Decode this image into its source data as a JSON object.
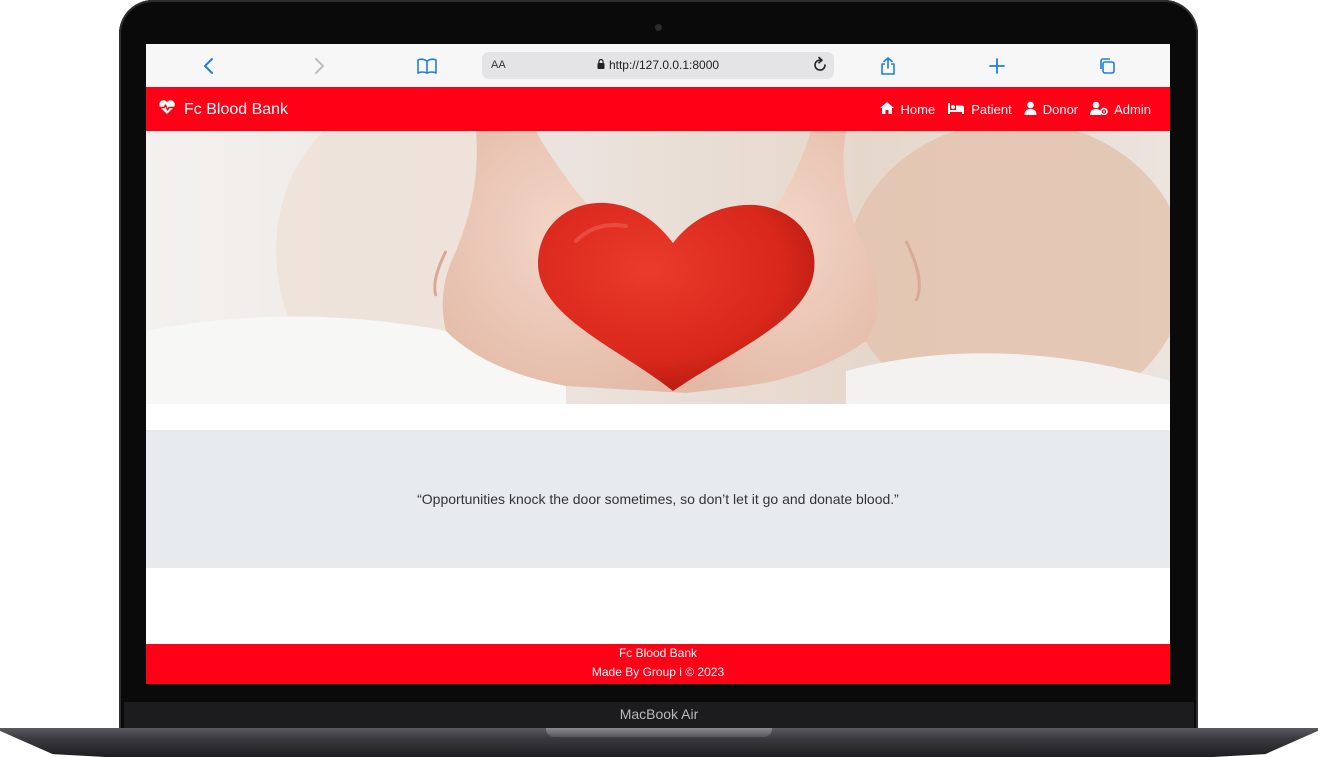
{
  "device": {
    "label": "MacBook Air"
  },
  "browser": {
    "text_size_label": "AA",
    "url": "http://127.0.0.1:8000"
  },
  "site": {
    "brand": "Fc Blood Bank",
    "nav": [
      {
        "label": "Home",
        "icon": "home-icon"
      },
      {
        "label": "Patient",
        "icon": "bed-icon"
      },
      {
        "label": "Donor",
        "icon": "user-icon"
      },
      {
        "label": "Admin",
        "icon": "user-gear-icon"
      }
    ],
    "quote": "“Opportunities knock the door sometimes, so don’t let it go and donate blood.”",
    "footer": {
      "line1": "Fc Blood Bank",
      "line2": "Made By Group i © 2023"
    }
  },
  "colors": {
    "brand_red": "#ff0016",
    "quote_band": "#e8ebee",
    "browser_accent": "#1f7fe0"
  }
}
